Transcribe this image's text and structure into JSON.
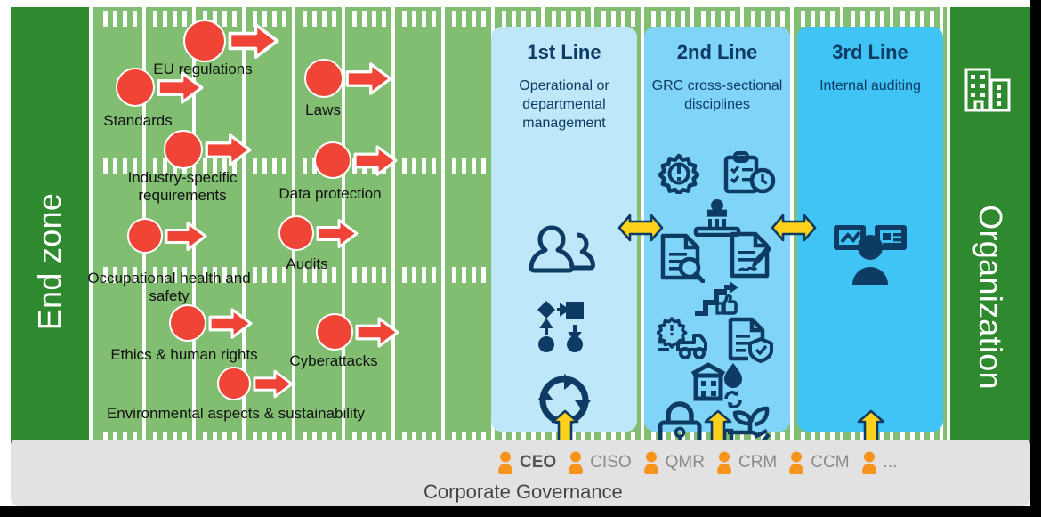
{
  "endzones": {
    "left_label": "End zone",
    "right_label": "Organization",
    "building_icon": "office-building-icon",
    "color": "#2F8A2F"
  },
  "field": {
    "color": "#82BE72",
    "line_color": "#FFFFFF"
  },
  "risks": {
    "marker_color": "#F04437",
    "items": [
      {
        "label": "EU regulations",
        "icon": "red-dot-icon",
        "arrow": "right-arrow-icon"
      },
      {
        "label": "Standards",
        "icon": "red-dot-icon",
        "arrow": "right-arrow-icon"
      },
      {
        "label": "Industry-specific requirements",
        "icon": "red-dot-icon",
        "arrow": "right-arrow-icon"
      },
      {
        "label": "Occupational health and safety",
        "icon": "red-dot-icon",
        "arrow": "right-arrow-icon"
      },
      {
        "label": "Ethics & human rights",
        "icon": "red-dot-icon",
        "arrow": "right-arrow-icon"
      },
      {
        "label": "Environmental aspects & sustainability",
        "icon": "red-dot-icon",
        "arrow": "right-arrow-icon"
      },
      {
        "label": "Laws",
        "icon": "red-dot-icon",
        "arrow": "right-arrow-icon"
      },
      {
        "label": "Data protection",
        "icon": "red-dot-icon",
        "arrow": "right-arrow-icon"
      },
      {
        "label": "Audits",
        "icon": "red-dot-icon",
        "arrow": "right-arrow-icon"
      },
      {
        "label": "Cyberattacks",
        "icon": "red-dot-icon",
        "arrow": "right-arrow-icon"
      }
    ]
  },
  "lines": [
    {
      "title": "1st Line",
      "subtitle": "Operational or departmental management",
      "color": "#BEE7FA",
      "icons": [
        "people-group-icon",
        "process-flow-icon",
        "continuous-cycle-icon"
      ]
    },
    {
      "title": "2nd Line",
      "subtitle": "GRC cross-sectional disciplines",
      "color": "#7FD4F7",
      "icons": [
        "risk-gear-icon",
        "audit-clipboard-clock-icon",
        "government-building-icon",
        "document-search-icon",
        "signed-contract-icon",
        "compliance-steps-thumbup-icon",
        "supply-chain-risk-truck-icon",
        "document-shield-icon",
        "business-continuity-icon",
        "information-security-lock-icon",
        "sustainability-hand-plant-icon"
      ]
    },
    {
      "title": "3rd Line",
      "subtitle": "Internal auditing",
      "color": "#40C4F5",
      "icons": [
        "auditor-dashboard-person-icon"
      ]
    }
  ],
  "connectors": {
    "color": "#FFD11A",
    "outline": "#0D3B63",
    "horizontal": [
      "arrow-1st-to-2nd-line",
      "arrow-2nd-to-3rd-line"
    ],
    "vertical": [
      "arrow-1st-line-to-governance",
      "arrow-2nd-line-to-governance",
      "arrow-3rd-line-to-governance"
    ]
  },
  "governance": {
    "caption": "Corporate Governance",
    "roles": [
      {
        "name": "CEO",
        "primary": true
      },
      {
        "name": "CISO",
        "primary": false
      },
      {
        "name": "QMR",
        "primary": false
      },
      {
        "name": "CRM",
        "primary": false
      },
      {
        "name": "CCM",
        "primary": false
      },
      {
        "name": "...",
        "primary": false
      }
    ],
    "role_icon": "person-silhouette-icon",
    "role_icon_color": "#F7941E",
    "bar_color": "#E2E2E2"
  }
}
